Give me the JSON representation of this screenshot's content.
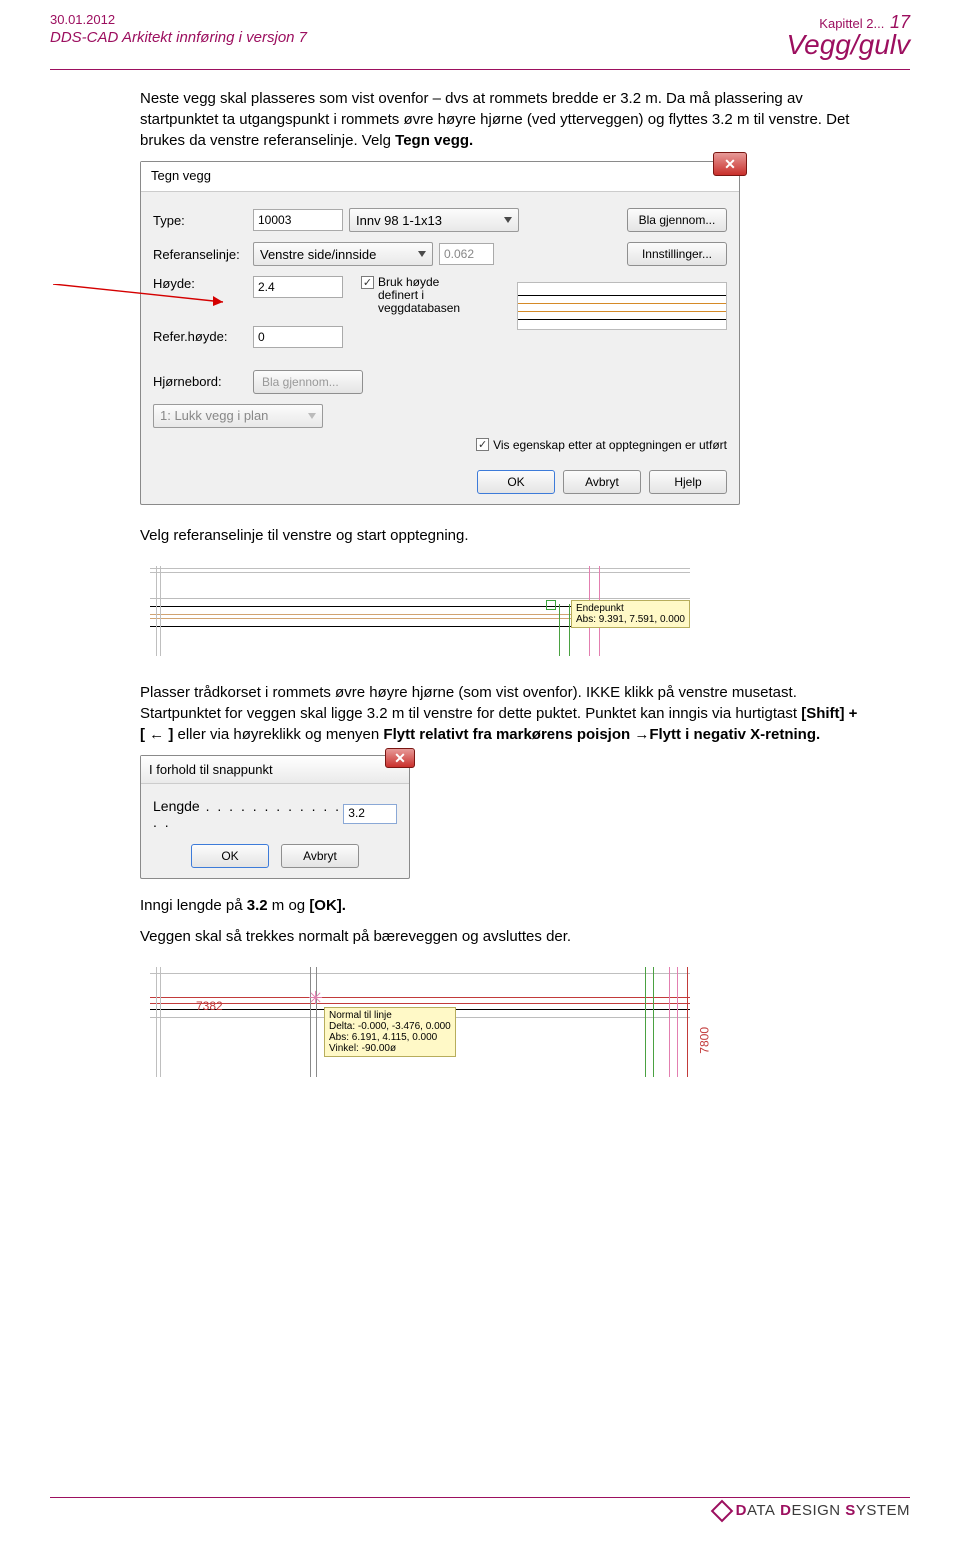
{
  "header": {
    "date": "30.01.2012",
    "doc_title": "DDS-CAD Arkitekt  innføring i versjon 7",
    "chapter_label": "Kapittel 2...",
    "page_number": "17",
    "section_title": "Vegg/gulv"
  },
  "para1_a": "Neste vegg skal plasseres som vist ovenfor – dvs at rommets bredde er 3.2 m. Da må plassering av startpunktet ta utgangspunkt i rommets øvre høyre hjørne (ved ytterveggen) og flyttes 3.2 m til venstre. Det brukes da venstre referanselinje. Velg ",
  "para1_b": "Tegn vegg.",
  "dialog1": {
    "title": "Tegn vegg",
    "close_glyph": "✕",
    "type_label": "Type:",
    "type_num": "10003",
    "type_name": "Innv 98 1-1x13",
    "type_btn": "Bla gjennom...",
    "ref_label": "Referanselinje:",
    "ref_value": "Venstre side/innside",
    "ref_num": "0.062",
    "ref_btn": "Innstillinger...",
    "hoyde_label": "Høyde:",
    "hoyde_val": "2.4",
    "chk1_label": "Bruk høyde definert i veggdatabasen",
    "refh_label": "Refer.høyde:",
    "refh_val": "0",
    "hjorne_label": "Hjørnebord:",
    "hjorne_btn": "Bla gjennom...",
    "lukk_label": "1: Lukk vegg i plan",
    "vis_label": "Vis egenskap etter at opptegningen er utført",
    "ok": "OK",
    "avbryt": "Avbryt",
    "hjelp": "Hjelp"
  },
  "para2": "Velg referanselinje til venstre og start opptegning.",
  "fig2_tip_title": "Endepunkt",
  "fig2_tip_coord": "Abs: 9.391, 7.591, 0.000",
  "para3_a": "Plasser trådkorset i rommets øvre høyre hjørne (som vist ovenfor). IKKE klikk på venstre musetast. Startpunktet for veggen skal ligge 3.2 m til venstre for dette puktet. Punktet kan inngis via hurtigtast ",
  "para3_b": "[Shift] + [ ← ]",
  "para3_c": " eller via høyreklikk og menyen ",
  "para3_d": "Flytt relativt fra markørens poisjon ",
  "para3_e": "→",
  "para3_f": "Flytt i negativ X-retning.",
  "dialog2": {
    "title": "I forhold til snappunkt",
    "length_label": "Lengde",
    "length_val": "3.2",
    "ok": "OK",
    "avbryt": "Avbryt",
    "close_glyph": "✕"
  },
  "para4_a": "Inngi lengde på ",
  "para4_b": "3.2",
  "para4_c": " m og ",
  "para4_d": "[OK].",
  "para5": "Veggen skal så trekkes normalt på bæreveggen og avsluttes der.",
  "fig4_dim_left": "7382",
  "fig4_dim_right": "7800",
  "fig4_tip_l1": "Normal til linje",
  "fig4_tip_l2": "Delta: -0.000, -3.476, 0.000",
  "fig4_tip_l3": "Abs: 6.191, 4.115, 0.000",
  "fig4_tip_l4": "Vinkel: -90.00ø",
  "footer": {
    "brand_a": "D",
    "brand_b": "ATA",
    "brand_c": "D",
    "brand_d": "ESIGN",
    "brand_e": "S",
    "brand_f": "YSTEM"
  }
}
